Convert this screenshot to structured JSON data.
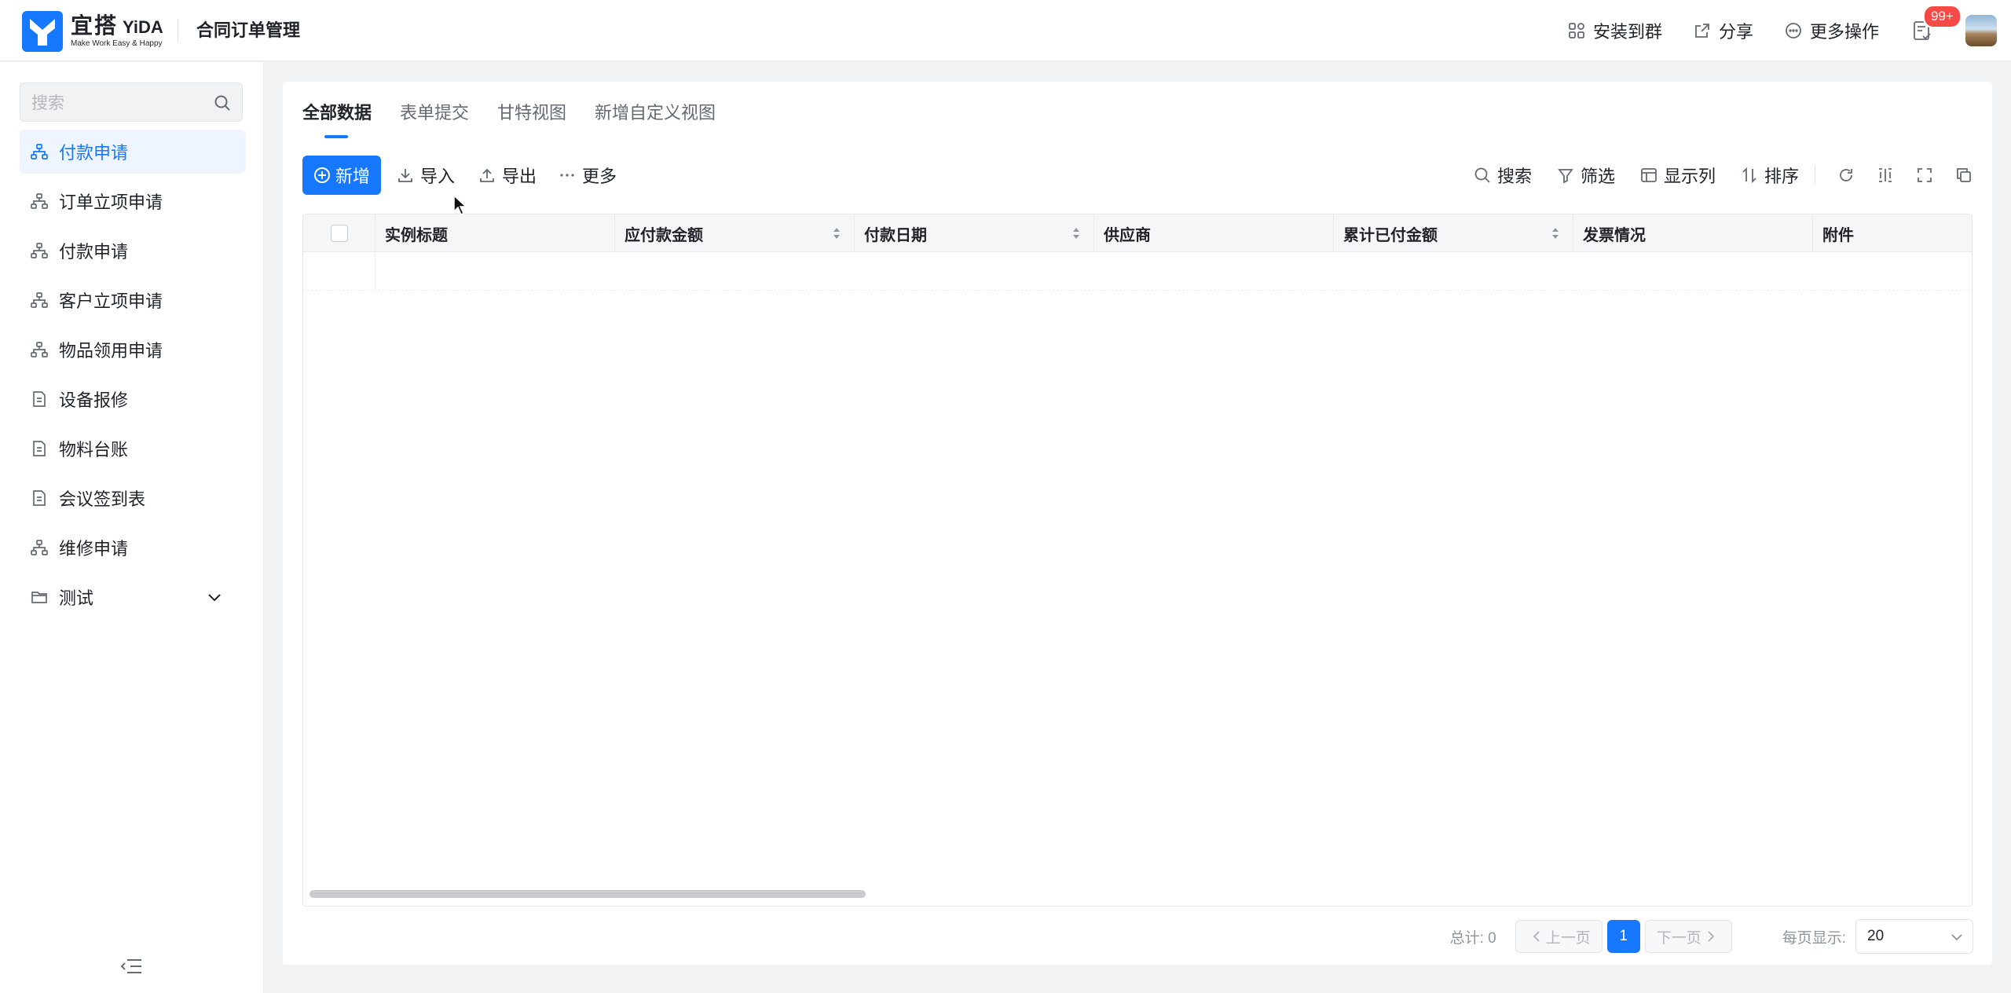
{
  "header": {
    "logo_cn": "宜搭",
    "logo_en": "YiDA",
    "logo_tagline": "Make Work Easy & Happy",
    "app_title": "合同订单管理",
    "actions": {
      "install": "安装到群",
      "share": "分享",
      "more": "更多操作"
    },
    "todo_badge": "99+"
  },
  "sidebar": {
    "search_placeholder": "搜索",
    "items": [
      {
        "label": "付款申请",
        "icon": "flow-icon",
        "active": true
      },
      {
        "label": "订单立项申请",
        "icon": "flow-icon"
      },
      {
        "label": "付款申请",
        "icon": "flow-icon"
      },
      {
        "label": "客户立项申请",
        "icon": "flow-icon"
      },
      {
        "label": "物品领用申请",
        "icon": "flow-icon"
      },
      {
        "label": "设备报修",
        "icon": "form-icon"
      },
      {
        "label": "物料台账",
        "icon": "form-icon"
      },
      {
        "label": "会议签到表",
        "icon": "form-icon"
      },
      {
        "label": "维修申请",
        "icon": "flow-icon"
      },
      {
        "label": "测试",
        "icon": "folder-icon"
      }
    ]
  },
  "tabs": [
    "全部数据",
    "表单提交",
    "甘特视图",
    "新增自定义视图"
  ],
  "toolbar": {
    "new": "新增",
    "import": "导入",
    "export": "导出",
    "more": "更多",
    "search": "搜索",
    "filter": "筛选",
    "columns": "显示列",
    "sort": "排序"
  },
  "table": {
    "columns": [
      "实例标题",
      "应付款金额",
      "付款日期",
      "供应商",
      "累计已付金额",
      "发票情况",
      "附件"
    ]
  },
  "pagination": {
    "total": "总计: 0",
    "prev": "上一页",
    "current_page": "1",
    "next": "下一页",
    "per_page_label": "每页显示:",
    "per_page_value": "20"
  },
  "colors": {
    "primary": "#1677ff",
    "badge": "#f54a45"
  }
}
